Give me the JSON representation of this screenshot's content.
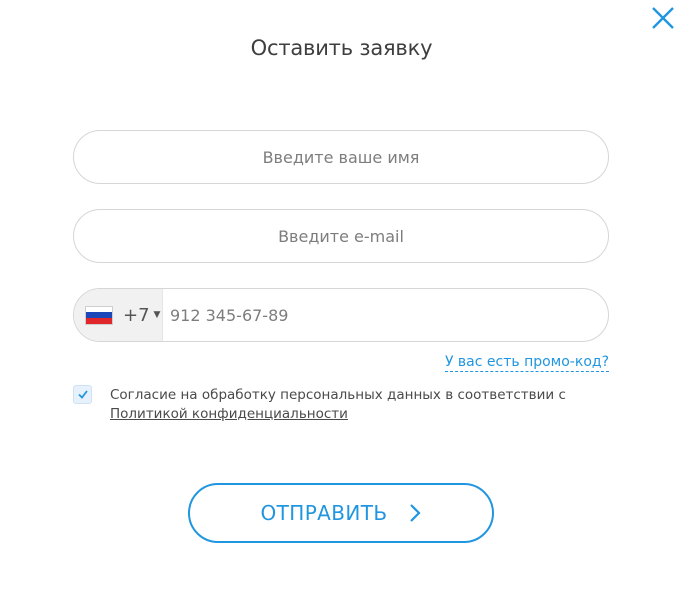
{
  "modal": {
    "title": "Оставить заявку",
    "close_icon": "close-icon",
    "accent_color": "#2196e0"
  },
  "form": {
    "name_placeholder": "Введите ваше имя",
    "email_placeholder": "Введите e-mail",
    "phone": {
      "country_flag": "russia-flag-icon",
      "dial_code": "+7",
      "placeholder": "912 345-67-89"
    },
    "promo_link": "У вас есть промо-код?",
    "consent": {
      "checked": true,
      "text": "Согласие на обработку персональных данных в соответствии с",
      "link_text": "Политикой конфиденциальности"
    },
    "submit_label": "ОТПРАВИТЬ"
  }
}
